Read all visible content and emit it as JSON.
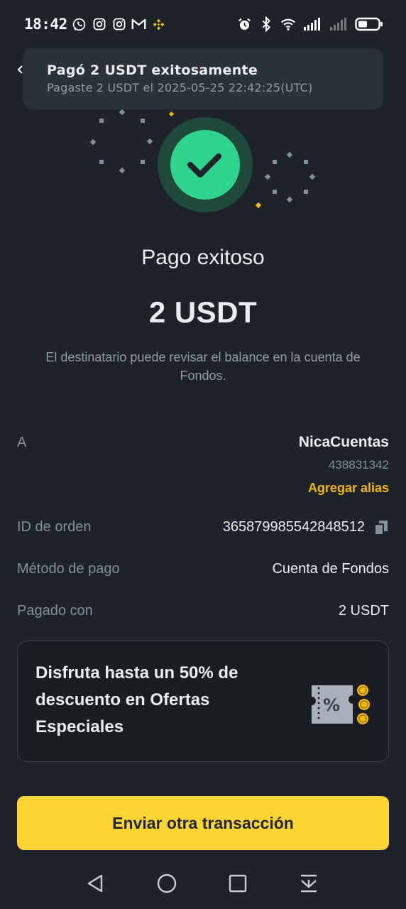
{
  "status_bar": {
    "time": "18:42",
    "notification_icons": [
      "whatsapp-icon",
      "instagram-icon",
      "instagram-icon",
      "gmail-icon",
      "binance-icon"
    ],
    "system_icons": [
      "alarm-icon",
      "bluetooth-icon",
      "wifi-icon",
      "signal-icon",
      "signal-icon",
      "battery-icon"
    ]
  },
  "toast": {
    "title": "Pagó 2 USDT exitosamente",
    "subtitle": "Pagaste 2 USDT el 2025-05-25 22:42:25(UTC)"
  },
  "result": {
    "title": "Pago exitoso",
    "amount": "2 USDT",
    "note": "El destinatario puede revisar el balance en la cuenta de Fondos."
  },
  "details": {
    "recipient": {
      "label": "A",
      "name": "NicaCuentas",
      "id": "438831342",
      "alias_link": "Agregar alias"
    },
    "order": {
      "label": "ID de orden",
      "value": "365879985542848512"
    },
    "method": {
      "label": "Método de pago",
      "value": "Cuenta de Fondos"
    },
    "paid_with": {
      "label": "Pagado con",
      "value": "2 USDT"
    }
  },
  "promo": {
    "text": "Disfruta hasta un 50% de descuento en Ofertas Especiales"
  },
  "cta": {
    "label": "Enviar otra transacción"
  },
  "colors": {
    "background": "#1e2329",
    "accent_yellow": "#fcd535",
    "link_yellow": "#f0b90b",
    "success_green": "#2ed38c",
    "muted_text": "#848e9c"
  },
  "nav": [
    "back-icon",
    "home-icon",
    "recents-icon",
    "notification-shade-icon"
  ]
}
